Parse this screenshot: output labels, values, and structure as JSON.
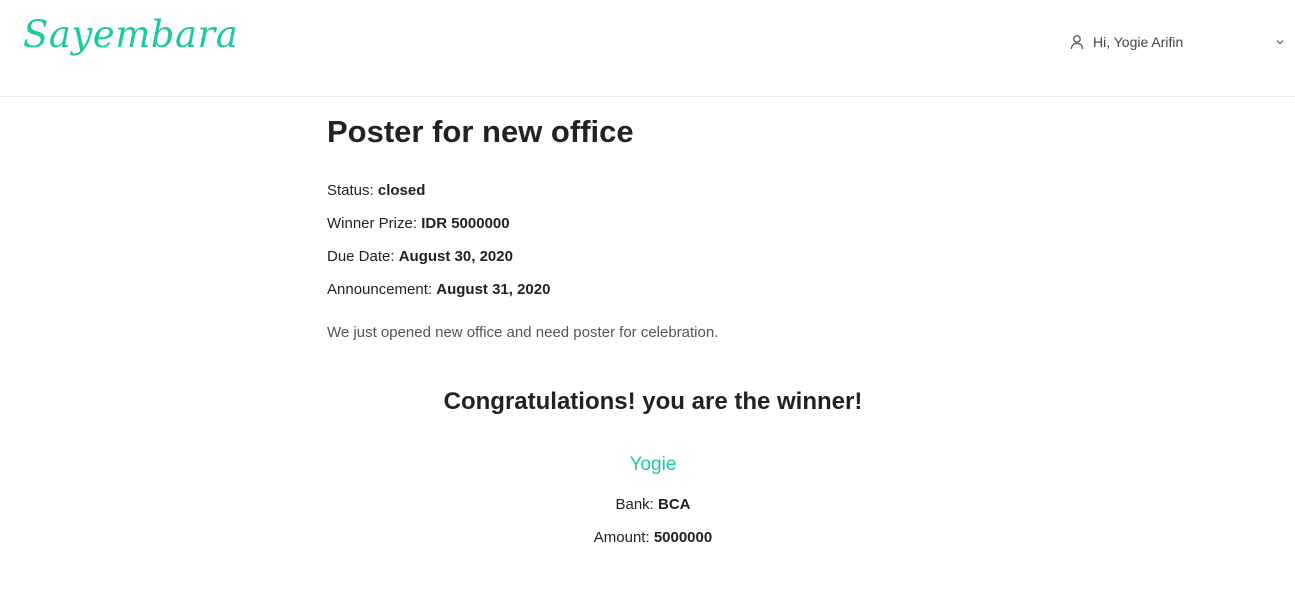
{
  "navbar": {
    "logo": "Sayembara",
    "user_greeting": "Hi, Yogie Arifin",
    "user_icon": "user-icon",
    "dropdown_icon": "chevron-down-icon"
  },
  "contest": {
    "title": "Poster for new office",
    "status_label": "Status:",
    "status_value": "closed",
    "prize_label": "Winner Prize:",
    "prize_value": "IDR 5000000",
    "due_label": "Due Date:",
    "due_value": "August 30, 2020",
    "announcement_label": "Announcement:",
    "announcement_value": "August 31, 2020",
    "description": "We just opened new office and need poster for celebration."
  },
  "winner": {
    "heading": "Congratulations! you are the winner!",
    "name": "Yogie",
    "bank_label": "Bank:",
    "bank_value": "BCA",
    "amount_label": "Amount:",
    "amount_value": "5000000"
  },
  "colors": {
    "brand": "#1ec9a1",
    "text": "#222222",
    "muted": "#555555"
  }
}
